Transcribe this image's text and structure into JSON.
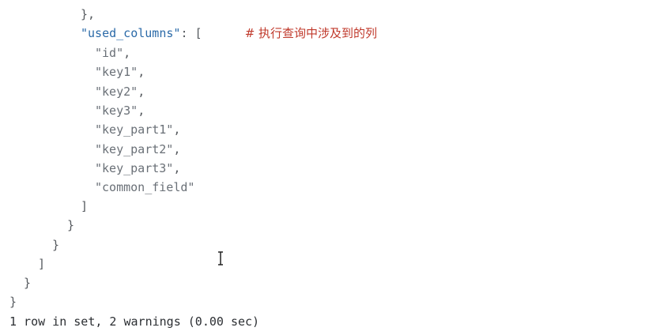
{
  "editor": {
    "lines": [
      {
        "indent": "      ",
        "segments": [
          {
            "t": "punct",
            "v": "},"
          }
        ]
      },
      {
        "indent": "      ",
        "segments": [
          {
            "t": "key",
            "v": "\"used_columns\""
          },
          {
            "t": "punct",
            "v": ": ["
          },
          {
            "t": "punct",
            "v": "      "
          },
          {
            "t": "cmt",
            "v": "# 执行查询中涉及到的列"
          }
        ]
      },
      {
        "indent": "        ",
        "segments": [
          {
            "t": "str",
            "v": "\"id\""
          },
          {
            "t": "punct",
            "v": ","
          }
        ]
      },
      {
        "indent": "        ",
        "segments": [
          {
            "t": "str",
            "v": "\"key1\""
          },
          {
            "t": "punct",
            "v": ","
          }
        ]
      },
      {
        "indent": "        ",
        "segments": [
          {
            "t": "str",
            "v": "\"key2\""
          },
          {
            "t": "punct",
            "v": ","
          }
        ]
      },
      {
        "indent": "        ",
        "segments": [
          {
            "t": "str",
            "v": "\"key3\""
          },
          {
            "t": "punct",
            "v": ","
          }
        ]
      },
      {
        "indent": "        ",
        "segments": [
          {
            "t": "str",
            "v": "\"key_part1\""
          },
          {
            "t": "punct",
            "v": ","
          }
        ]
      },
      {
        "indent": "        ",
        "segments": [
          {
            "t": "str",
            "v": "\"key_part2\""
          },
          {
            "t": "punct",
            "v": ","
          }
        ]
      },
      {
        "indent": "        ",
        "segments": [
          {
            "t": "str",
            "v": "\"key_part3\""
          },
          {
            "t": "punct",
            "v": ","
          }
        ]
      },
      {
        "indent": "        ",
        "segments": [
          {
            "t": "str",
            "v": "\"common_field\""
          }
        ]
      },
      {
        "indent": "      ",
        "segments": [
          {
            "t": "punct",
            "v": "]"
          }
        ]
      },
      {
        "indent": "     ",
        "segments": [
          {
            "t": "punct",
            "v": "}"
          }
        ]
      },
      {
        "indent": "    ",
        "segments": [
          {
            "t": "punct",
            "v": "}"
          }
        ]
      },
      {
        "indent": "   ",
        "segments": [
          {
            "t": "punct",
            "v": "]"
          }
        ]
      },
      {
        "indent": "  ",
        "segments": [
          {
            "t": "punct",
            "v": "}"
          }
        ]
      },
      {
        "indent": "",
        "segments": [
          {
            "t": "punct",
            "v": "}"
          }
        ]
      },
      {
        "indent": "",
        "segments": [
          {
            "t": "plain",
            "v": "1 row in set, 2 warnings (0.00 sec)"
          }
        ]
      }
    ]
  },
  "cursor_icon": "text-cursor-icon",
  "colors": {
    "key": "#2b6aa8",
    "comment": "#c0392b",
    "string": "#6a7077",
    "punct": "#55595e"
  }
}
